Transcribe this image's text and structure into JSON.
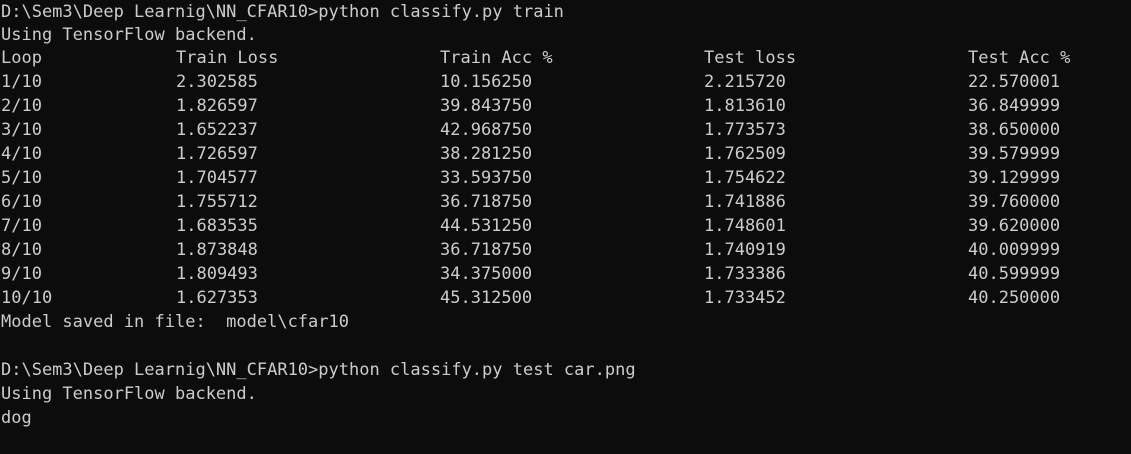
{
  "terminal": {
    "session1": {
      "prompt": "D:\\Sem3\\Deep Learnig\\NN_CFAR10>",
      "command": "python classify.py train",
      "backend_msg": "Using TensorFlow backend.",
      "table": {
        "headers": [
          "Loop",
          "Train Loss",
          "Train Acc %",
          "Test loss",
          "Test Acc %"
        ],
        "rows": [
          [
            "1/10",
            "2.302585",
            "10.156250",
            "2.215720",
            "22.570001"
          ],
          [
            "2/10",
            "1.826597",
            "39.843750",
            "1.813610",
            "36.849999"
          ],
          [
            "3/10",
            "1.652237",
            "42.968750",
            "1.773573",
            "38.650000"
          ],
          [
            "4/10",
            "1.726597",
            "38.281250",
            "1.762509",
            "39.579999"
          ],
          [
            "5/10",
            "1.704577",
            "33.593750",
            "1.754622",
            "39.129999"
          ],
          [
            "6/10",
            "1.755712",
            "36.718750",
            "1.741886",
            "39.760000"
          ],
          [
            "7/10",
            "1.683535",
            "44.531250",
            "1.748601",
            "39.620000"
          ],
          [
            "8/10",
            "1.873848",
            "36.718750",
            "1.740919",
            "40.009999"
          ],
          [
            "9/10",
            "1.809493",
            "34.375000",
            "1.733386",
            "40.599999"
          ],
          [
            "10/10",
            "1.627353",
            "45.312500",
            "1.733452",
            "40.250000"
          ]
        ]
      },
      "saved_msg": "Model saved in file:  model\\cfar10"
    },
    "session2": {
      "prompt": "D:\\Sem3\\Deep Learnig\\NN_CFAR10>",
      "command": "python classify.py test car.png",
      "backend_msg": "Using TensorFlow backend.",
      "result": "dog"
    }
  }
}
